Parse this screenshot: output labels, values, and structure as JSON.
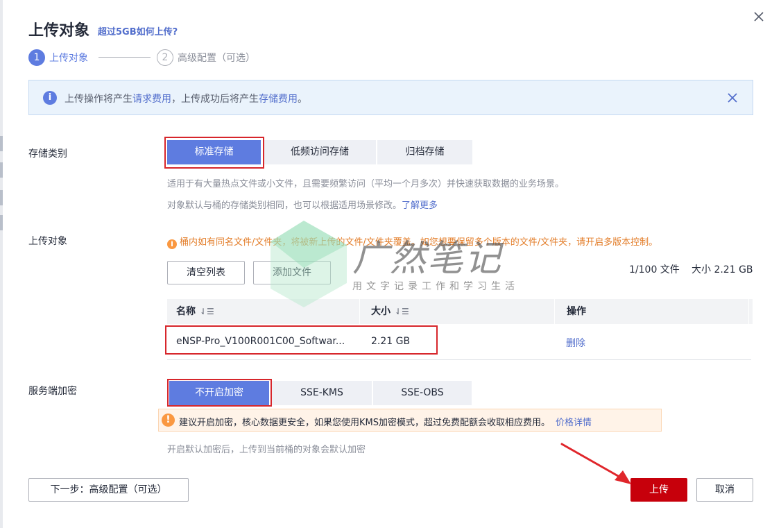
{
  "dialog": {
    "title": "上传对象",
    "title_link": "超过5GB如何上传?"
  },
  "steps": [
    {
      "number": "1",
      "label": "上传对象",
      "active": true
    },
    {
      "number": "2",
      "label": "高级配置（可选）",
      "active": false
    }
  ],
  "info_bar": {
    "text_1": "上传操作将产生",
    "link_1": "请求费用",
    "text_2": "，上传成功后将产生",
    "link_2": "存储费用",
    "text_3": "。"
  },
  "storage_class": {
    "label": "存储类别",
    "options": [
      "标准存储",
      "低频访问存储",
      "归档存储"
    ],
    "selected": "标准存储",
    "hint_1": "适用于有大量热点文件或小文件，且需要频繁访问（平均一个月多次）并快速获取数据的业务场景。",
    "hint_2": "对象默认与桶的存储类别相同，也可以根据适用场景修改。",
    "hint_2_link": "了解更多"
  },
  "upload_objects": {
    "label": "上传对象",
    "warning": "桶内如有同名文件/文件夹，将被新上传的文件/文件夹覆盖。如您想要保留多个版本的文件/文件夹，请开启多版本控制。",
    "clear_button": "清空列表",
    "add_button": "添加文件",
    "file_count": "1/100 文件",
    "total_size": "大小 2.21 GB",
    "columns": [
      "名称",
      "大小",
      "操作"
    ],
    "rows": [
      {
        "name": "eNSP-Pro_V100R001C00_Softwar...",
        "size": "2.21 GB",
        "action": "删除"
      }
    ]
  },
  "encryption": {
    "label": "服务端加密",
    "options": [
      "不开启加密",
      "SSE-KMS",
      "SSE-OBS"
    ],
    "selected": "不开启加密",
    "warning": "建议开启加密，核心数据更安全，如果您使用KMS加密模式，超过免费配额会收取相应费用。",
    "warning_link": "价格详情",
    "hint": "开启默认加密后，上传到当前桶的对象会默认加密"
  },
  "footer": {
    "next_button": "下一步：高级配置（可选）",
    "upload_button": "上传",
    "cancel_button": "取消"
  },
  "watermark": {
    "main": "广然笔记",
    "sub": "用文字记录工作和学习生活"
  },
  "colors": {
    "primary": "#5e7ce0",
    "upload_button": "#c7000b",
    "annotation_red": "#d7262b",
    "warning_orange": "#e37d29",
    "link": "#526ecc"
  },
  "icons": [
    "close-icon",
    "info-icon",
    "warning-icon",
    "sort-icon",
    "arrow-annotation"
  ]
}
